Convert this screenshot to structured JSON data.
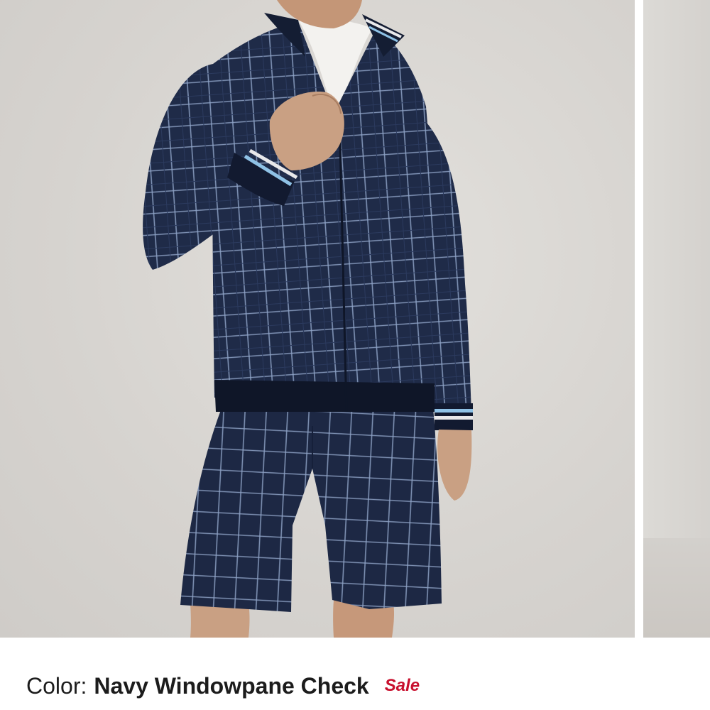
{
  "product": {
    "image_alt": "Model wearing navy windowpane check jacket and shorts"
  },
  "color": {
    "label": "Color:",
    "value": "Navy Windowpane Check",
    "badge": "Sale"
  },
  "theme": {
    "badge_color": "#c8102e",
    "fabric_color": "#1f2b48",
    "background_color": "#d8d5d1"
  }
}
